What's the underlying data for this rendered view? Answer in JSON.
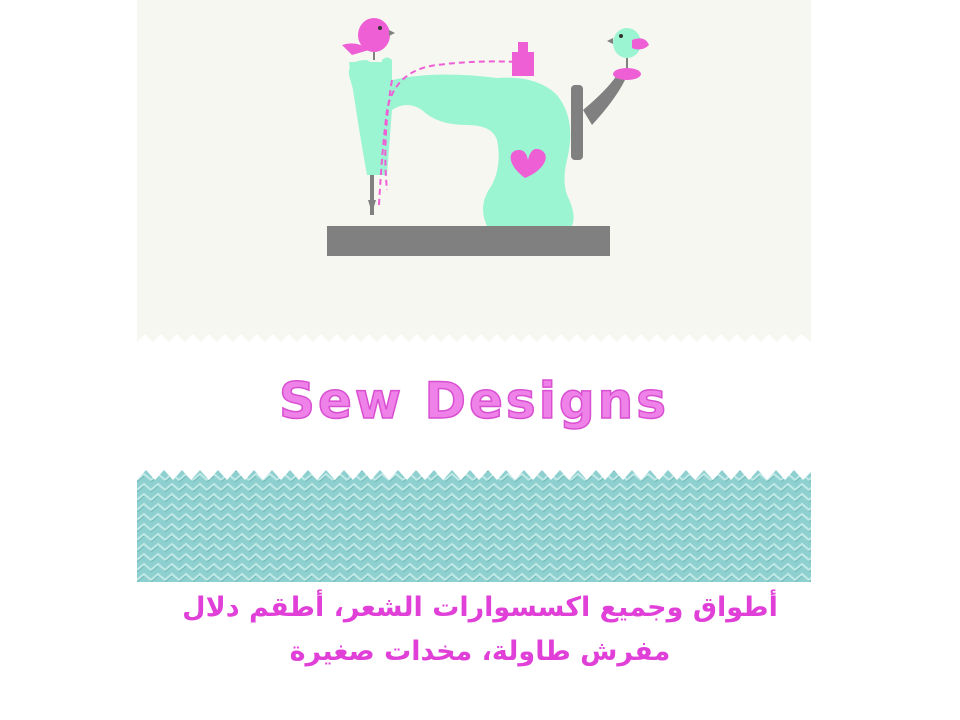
{
  "brand": {
    "title": "Sew Designs"
  },
  "caption": {
    "line1": "أطواق وجميع اكسسوارات الشعر، أطقم دلال",
    "line2": "مفرش طاولة، مخدات صغيرة"
  },
  "colors": {
    "machine_body": "#9cf5d2",
    "accent_pink": "#ee5fd5",
    "base_gray": "#808080",
    "fabric_teal": "#8ed0cf",
    "caption_text": "#e040d8",
    "title_fill": "#ee82e8"
  },
  "icons": [
    "sewing-machine-icon",
    "bird-icon",
    "heart-icon",
    "thread-spool-icon"
  ]
}
